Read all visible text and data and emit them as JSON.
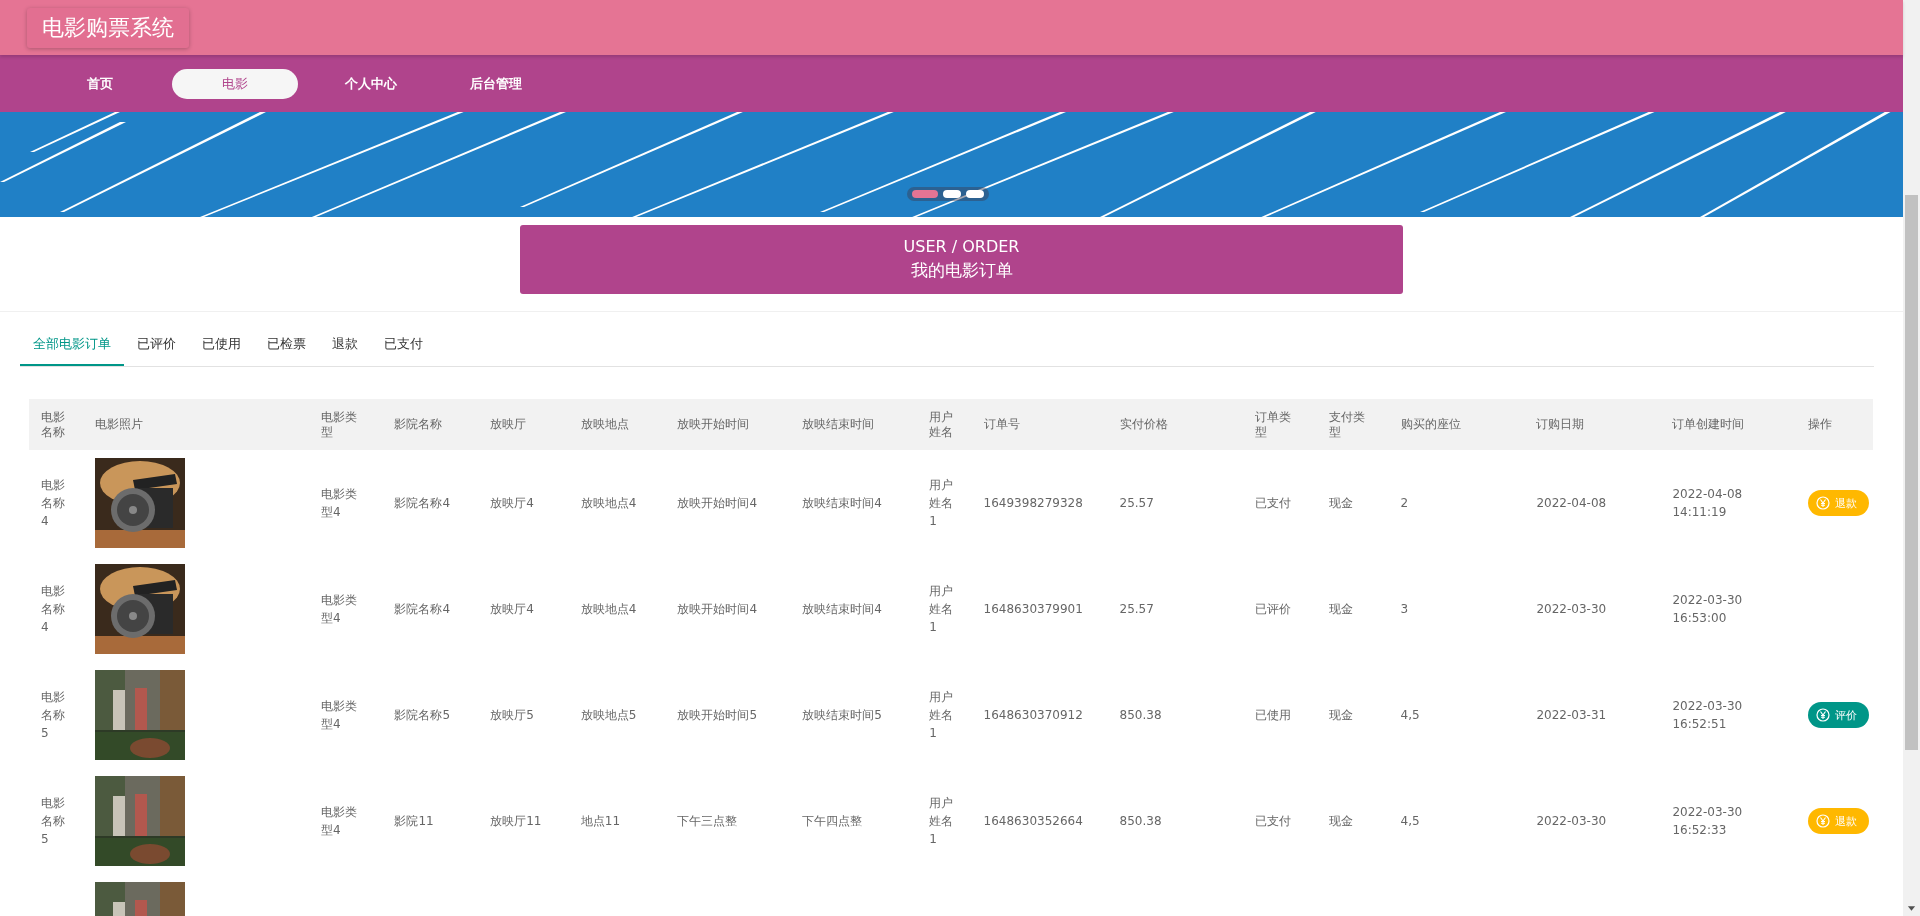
{
  "header": {
    "title": "电影购票系统"
  },
  "nav": [
    {
      "label": "首页",
      "selected": false
    },
    {
      "label": "电影",
      "selected": true
    },
    {
      "label": "个人中心",
      "selected": false
    },
    {
      "label": "后台管理",
      "selected": false
    }
  ],
  "banner": {
    "kind": "picture",
    "dots": [
      {
        "selected": true
      },
      {
        "selected": false
      },
      {
        "selected": false
      }
    ]
  },
  "section_title": {
    "english": "USER / ORDER",
    "chinese": "我的电影订单"
  },
  "tabs": [
    {
      "label": "全部电影订单",
      "selected": true
    },
    {
      "label": "已评价",
      "selected": false
    },
    {
      "label": "已使用",
      "selected": false
    },
    {
      "label": "已检票",
      "selected": false
    },
    {
      "label": "退款",
      "selected": false
    },
    {
      "label": "已支付",
      "selected": false
    }
  ],
  "table": {
    "columns": [
      "电影名称",
      "电影照片",
      "电影类型",
      "影院名称",
      "放映厅",
      "放映地点",
      "放映开始时间",
      "放映结束时间",
      "用户姓名",
      "订单号",
      "实付价格",
      "订单类型",
      "支付类型",
      "购买的座位",
      "订购日期",
      "订单创建时间",
      "操作"
    ],
    "rows": [
      {
        "cells": [
          "电影名称4",
          null,
          "电影类型4",
          "影院名称4",
          "放映厅4",
          "放映地点4",
          "放映开始时间4",
          "放映结束时间4",
          "用户姓名1",
          "1649398279328",
          "25.57",
          "已支付",
          "现金",
          "2",
          "2022-04-08",
          "2022-04-08 14:11:19"
        ],
        "photo": {
          "kind": "picture"
        },
        "action": {
          "kind": "refund",
          "label": "退款"
        }
      },
      {
        "cells": [
          "电影名称4",
          null,
          "电影类型4",
          "影院名称4",
          "放映厅4",
          "放映地点4",
          "放映开始时间4",
          "放映结束时间4",
          "用户姓名1",
          "1648630379901",
          "25.57",
          "已评价",
          "现金",
          "3",
          "2022-03-30",
          "2022-03-30 16:53:00"
        ],
        "photo": {
          "kind": "picture"
        }
      },
      {
        "cells": [
          "电影名称5",
          null,
          "电影类型4",
          "影院名称5",
          "放映厅5",
          "放映地点5",
          "放映开始时间5",
          "放映结束时间5",
          "用户姓名1",
          "1648630370912",
          "850.38",
          "已使用",
          "现金",
          "4,5",
          "2022-03-31",
          "2022-03-30 16:52:51"
        ],
        "photo": {
          "kind": "picture"
        },
        "action": {
          "kind": "review",
          "label": "评价"
        }
      },
      {
        "cells": [
          "电影名称5",
          null,
          "电影类型4",
          "影院11",
          "放映厅11",
          "地点11",
          "下午三点整",
          "下午四点整",
          "用户姓名1",
          "1648630352664",
          "850.38",
          "已支付",
          "现金",
          "4,5",
          "2022-03-30",
          "2022-03-30 16:52:33"
        ],
        "photo": {
          "kind": "picture"
        },
        "action": {
          "kind": "refund",
          "label": "退款"
        }
      },
      {
        "photo": {
          "kind": "picture"
        }
      }
    ]
  }
}
